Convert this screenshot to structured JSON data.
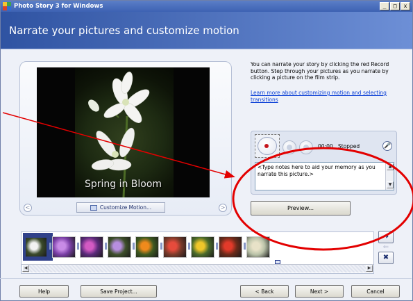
{
  "window": {
    "title": "Photo Story 3 for Windows",
    "minimize_label": "_",
    "maximize_label": "□",
    "close_label": "x"
  },
  "header": {
    "title": "Narrate your pictures and customize motion"
  },
  "preview": {
    "caption": "Spring in Bloom",
    "customize_motion_label": "Customize Motion...",
    "prev_label": "<",
    "next_label": ">"
  },
  "help": {
    "text": "You can narrate your story by clicking the red Record button. Step through your pictures as you narrate by clicking a picture on the film strip.",
    "link_text": "Learn more about customizing motion and selecting transitions"
  },
  "narration": {
    "time": "00:00",
    "status": "Stopped",
    "notes_placeholder": "<Type notes here to aid your memory as you narrate this picture.>",
    "preview_label": "Preview..."
  },
  "filmstrip": {
    "thumbnails": [
      {
        "name": "thumb-1",
        "color": "#3a4a2a",
        "accent": "#f2f2f2"
      },
      {
        "name": "thumb-2",
        "color": "#7a3fa6",
        "accent": "#c88be6"
      },
      {
        "name": "thumb-3",
        "color": "#5a2a7a",
        "accent": "#d35ac3"
      },
      {
        "name": "thumb-4",
        "color": "#3d4f2a",
        "accent": "#b78ee0"
      },
      {
        "name": "thumb-5",
        "color": "#3e5a20",
        "accent": "#f08a1c"
      },
      {
        "name": "thumb-6",
        "color": "#7a3a2a",
        "accent": "#e64b3c"
      },
      {
        "name": "thumb-7",
        "color": "#4a6a2a",
        "accent": "#f0c62a"
      },
      {
        "name": "thumb-8",
        "color": "#6a2a1a",
        "accent": "#e23a2a"
      },
      {
        "name": "thumb-9",
        "color": "#b9c2a8",
        "accent": "#e8e2c8"
      }
    ],
    "move_right_label": "➜",
    "move_left_label": "⇐",
    "remove_label": "✖"
  },
  "footer": {
    "help_label": "Help",
    "save_label": "Save Project...",
    "back_label": "< Back",
    "next_label": "Next >",
    "cancel_label": "Cancel"
  },
  "colors": {
    "annotation": "#e30000",
    "banner_start": "#2f53a2",
    "banner_end": "#6d8fd6",
    "record_red": "#c4141b"
  }
}
